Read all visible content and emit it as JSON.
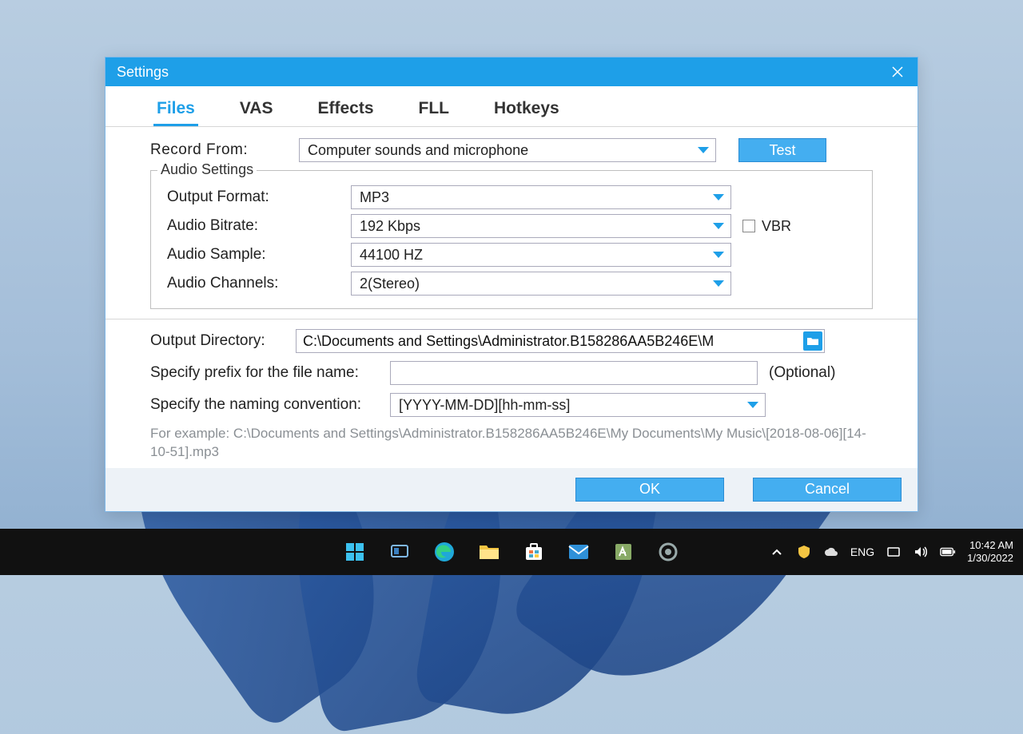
{
  "window": {
    "title": "Settings"
  },
  "tabs": {
    "files": "Files",
    "vas": "VAS",
    "effects": "Effects",
    "fll": "FLL",
    "hotkeys": "Hotkeys"
  },
  "record": {
    "label": "Record  From:",
    "value": "Computer sounds and microphone",
    "test": "Test"
  },
  "audio": {
    "legend": "Audio Settings",
    "format_label": "Output Format:",
    "format_value": "MP3",
    "bitrate_label": "Audio Bitrate:",
    "bitrate_value": "192 Kbps",
    "vbr_label": "VBR",
    "sample_label": "Audio Sample:",
    "sample_value": "44100 HZ",
    "channels_label": "Audio Channels:",
    "channels_value": "2(Stereo)"
  },
  "output": {
    "dir_label": "Output Directory:",
    "dir_value": "C:\\Documents and Settings\\Administrator.B158286AA5B246E\\M",
    "prefix_label": "Specify prefix for the file name:",
    "prefix_value": "",
    "optional": "(Optional)",
    "conv_label": "Specify the naming convention:",
    "conv_value": "[YYYY-MM-DD][hh-mm-ss]",
    "example": "For example: C:\\Documents and Settings\\Administrator.B158286AA5B246E\\My Documents\\My Music\\[2018-08-06][14-10-51].mp3"
  },
  "actions": {
    "ok": "OK",
    "cancel": "Cancel"
  },
  "taskbar": {
    "lang": "ENG",
    "time": "10:42 AM",
    "date": "1/30/2022"
  }
}
